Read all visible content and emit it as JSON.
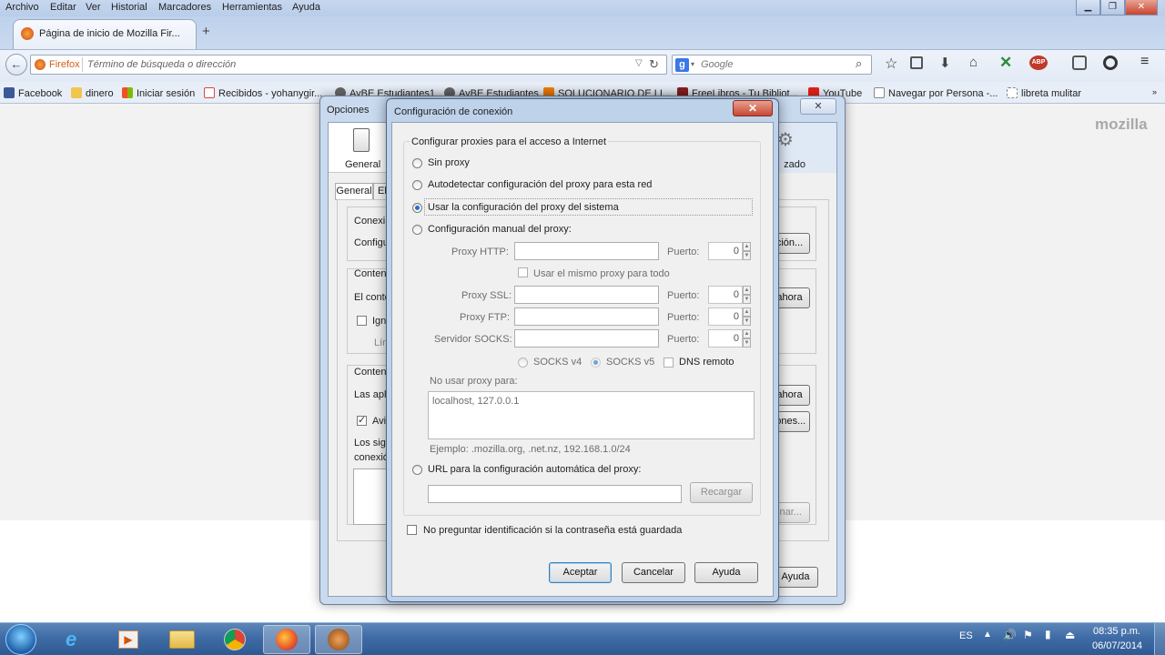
{
  "menu": [
    "Archivo",
    "Editar",
    "Ver",
    "Historial",
    "Marcadores",
    "Herramientas",
    "Ayuda"
  ],
  "tab": {
    "title": "Página de inicio de Mozilla Fir...",
    "new_tab": "+"
  },
  "urlbar": {
    "identity": "Firefox",
    "placeholder": "Término de búsqueda o dirección"
  },
  "search": {
    "engine": "Google",
    "placeholder": "Google"
  },
  "bookmarks": [
    "Facebook",
    "dinero",
    "Iniciar sesión",
    "Recibidos - yohanygir...",
    "AvBE Estudiantes1",
    "AvBE Estudiantes",
    "SOLUCIONARIO DE LI...",
    "FreeLibros - Tu Bibliot...",
    "YouTube",
    "Navegar por Persona -...",
    "libreta mulitar"
  ],
  "brand": "mozilla",
  "options": {
    "title": "Opciones",
    "panes": {
      "general": "General",
      "advanced": "Avanzado"
    },
    "tabs": [
      "General",
      "El"
    ],
    "rows": [
      "Conexi",
      "Configu",
      "Conten",
      "El conte",
      "Ign",
      "Lím",
      "Conten",
      "Las apli",
      "Avi",
      "Los sig",
      "conexió"
    ],
    "buttons": {
      "configuracion": "ción...",
      "ahora1": "ahora",
      "ahora2": "ahora",
      "excepciones": "iones...",
      "limpiar": "inar...",
      "ayuda": "Ayuda"
    }
  },
  "dialog": {
    "title": "Configuración de conexión",
    "close": "✕",
    "group_title": "Configurar proxies para el acceso a Internet",
    "radios": {
      "none": "Sin proxy",
      "auto_detect": "Autodetectar configuración del proxy para esta red",
      "system": "Usar la configuración del proxy del sistema",
      "manual": "Configuración manual del proxy:",
      "pac": "URL para la configuración automática del proxy:"
    },
    "selected_radio": "system",
    "proxy_labels": {
      "http": "Proxy HTTP:",
      "ssl": "Proxy SSL:",
      "ftp": "Proxy FTP:",
      "socks": "Servidor SOCKS:"
    },
    "port_label": "Puerto:",
    "port_values": {
      "http": "0",
      "ssl": "0",
      "ftp": "0",
      "socks": "0"
    },
    "same_proxy": "Usar el mismo proxy para todo",
    "socks_v4": "SOCKS v4",
    "socks_v5": "SOCKS v5",
    "remote_dns": "DNS remoto",
    "no_proxy_label": "No usar proxy para:",
    "no_proxy_value": "localhost, 127.0.0.1",
    "example": "Ejemplo: .mozilla.org, .net.nz, 192.168.1.0/24",
    "reload": "Recargar",
    "no_ask_auth": "No preguntar identificación si la contraseña está guardada",
    "ok": "Aceptar",
    "cancel": "Cancelar",
    "help": "Ayuda"
  },
  "taskbar": {
    "lang": "ES",
    "time": "08:35 p.m.",
    "date": "06/07/2014"
  },
  "colors": {
    "accent": "#1f6fd0",
    "taskbar": "#3f6ca6",
    "close": "#c64833"
  }
}
